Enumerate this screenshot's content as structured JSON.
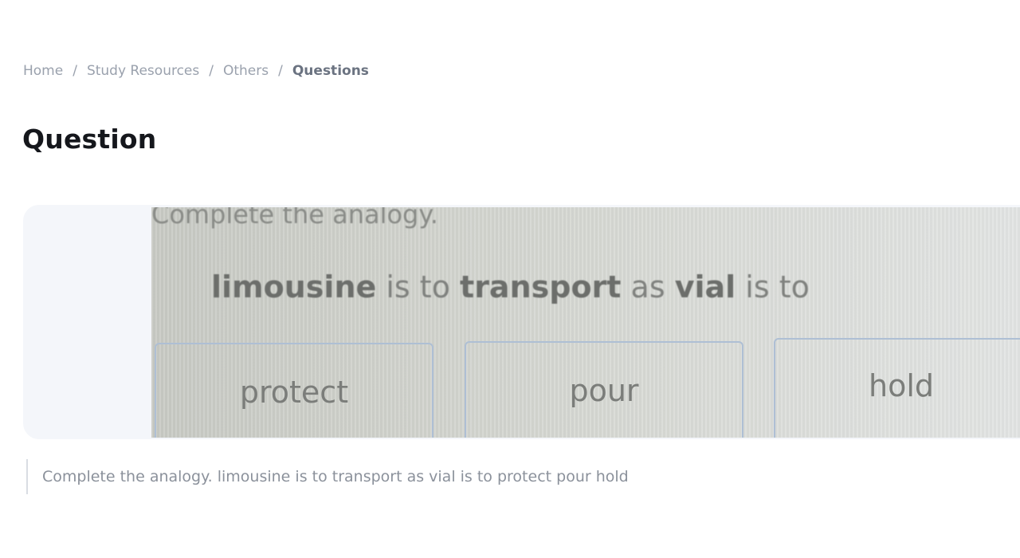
{
  "breadcrumb": {
    "items": [
      "Home",
      "Study Resources",
      "Others"
    ],
    "separator": "/",
    "current": "Questions"
  },
  "page_title": "Question",
  "question_image": {
    "prompt": "Complete the analogy.",
    "analogy": {
      "word1": "limousine",
      "connector1": " is to ",
      "word2": "transport",
      "connector2": " as ",
      "word3": "vial",
      "connector3": " is to"
    },
    "options": [
      "protect",
      "pour",
      "hold"
    ]
  },
  "caption": "Complete the analogy. limousine is to transport as vial is to protect pour hold"
}
